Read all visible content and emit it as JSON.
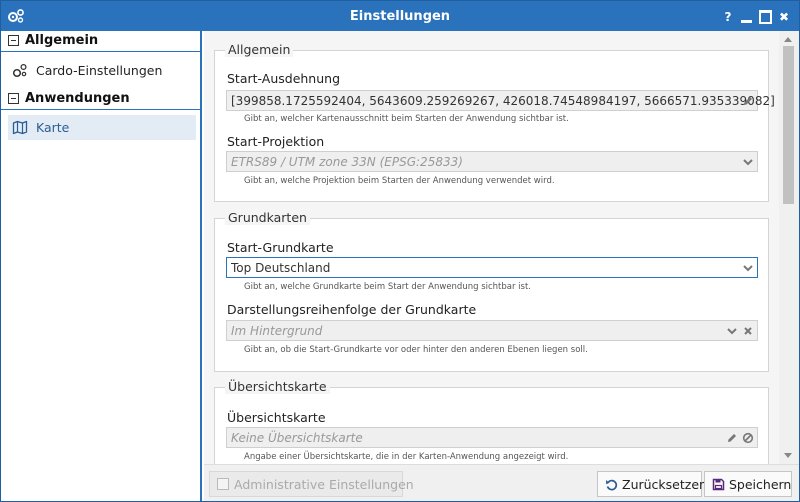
{
  "window": {
    "title": "Einstellungen",
    "help_label": "?",
    "close_label": "✖"
  },
  "nav": {
    "groups": [
      {
        "label": "Allgemein",
        "items": [
          {
            "label": "Cardo-Einstellungen",
            "icon": "gears-icon"
          }
        ]
      },
      {
        "label": "Anwendungen",
        "items": [
          {
            "label": "Karte",
            "icon": "map-icon",
            "active": true
          }
        ]
      }
    ]
  },
  "sections": {
    "allgemein": {
      "legend": "Allgemein",
      "extent": {
        "label": "Start-Ausdehnung",
        "value": "[399858.1725592404, 5643609.259269267, 426018.74548984197, 5666571.935339082]",
        "hint": "Gibt an, welcher Kartenausschnitt beim Starten der Anwendung sichtbar ist."
      },
      "projection": {
        "label": "Start-Projektion",
        "value": "ETRS89 / UTM zone 33N (EPSG:25833)",
        "hint": "Gibt an, welche Projektion beim Starten der Anwendung verwendet wird."
      }
    },
    "grundkarten": {
      "legend": "Grundkarten",
      "basemap": {
        "label": "Start-Grundkarte",
        "value": "Top Deutschland",
        "hint": "Gibt an, welche Grundkarte beim Start der Anwendung sichtbar ist."
      },
      "order": {
        "label": "Darstellungsreihenfolge der Grundkarte",
        "placeholder": "Im Hintergrund",
        "hint": "Gibt an, ob die Start-Grundkarte vor oder hinter den anderen Ebenen liegen soll."
      }
    },
    "uebersicht": {
      "legend": "Übersichtskarte",
      "overview": {
        "label": "Übersichtskarte",
        "placeholder": "Keine Übersichtskarte",
        "hint": "Angabe einer Übersichtskarte, die in der Karten-Anwendung angezeigt wird."
      }
    }
  },
  "footer": {
    "admin_label": "Administrative Einstellungen",
    "reset_label": "Zurücksetzen",
    "save_label": "Speichern"
  },
  "colors": {
    "accent": "#2a72bc",
    "nav_active_bg": "#e3ecf5"
  }
}
